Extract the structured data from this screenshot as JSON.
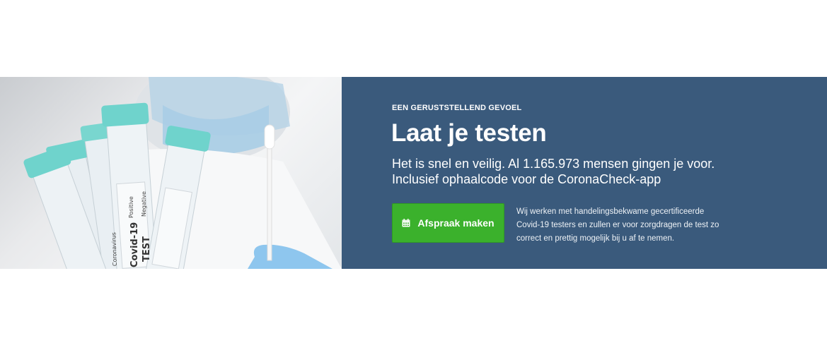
{
  "hero": {
    "eyebrow": "EEN GERUSTSTELLEND GEVOEL",
    "title": "Laat je testen",
    "subtitle": "Het is snel en veilig. Al 1.165.973 mensen gingen je voor. Inclusief ophaalcode voor de CoronaCheck-app",
    "cta_label": "Afspraak maken",
    "cta_icon": "calendar-icon",
    "note": "Wij werken met handelingsbekwame gecertificeerde Covid-19 testers en zullen er voor zorgdragen de test zo correct en prettig mogelijk bij u af te nemen."
  },
  "photo": {
    "tube_label_1": "Covid-19",
    "tube_label_2": "TEST",
    "tube_label_3": "Positive",
    "tube_label_4": "Negative",
    "tube_label_5": "Coronavirus"
  },
  "colors": {
    "panel": "#3a5a7c",
    "cta": "#3bb12c",
    "cap": "#6fd3cc"
  }
}
